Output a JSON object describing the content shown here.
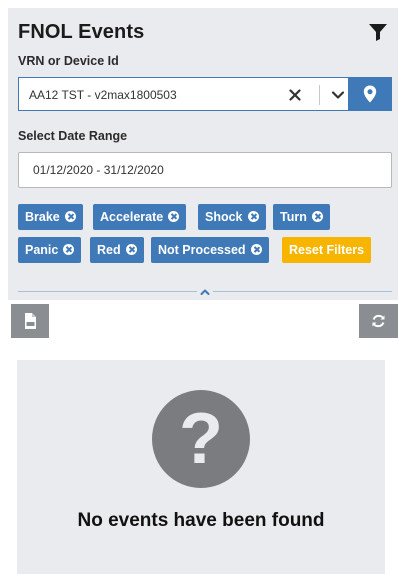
{
  "header": {
    "title": "FNOL Events"
  },
  "vrn": {
    "label": "VRN or Device Id",
    "value": "AA12 TST - v2max1800503"
  },
  "date_range": {
    "label": "Select Date Range",
    "value": "01/12/2020 - 31/12/2020"
  },
  "filters": {
    "chips": [
      {
        "label": "Brake"
      },
      {
        "label": "Accelerate"
      },
      {
        "label": "Shock"
      },
      {
        "label": "Turn"
      },
      {
        "label": "Panic"
      },
      {
        "label": "Red"
      },
      {
        "label": "Not Processed"
      }
    ],
    "reset_label": "Reset Filters"
  },
  "toolbar": {
    "csv_icon": "csv-file-icon",
    "refresh_icon": "refresh-icon"
  },
  "empty_state": {
    "icon": "question-circle-icon",
    "glyph": "?",
    "message": "No events have been found"
  },
  "colors": {
    "primary": "#3f79b8",
    "reset": "#f7b500",
    "panel_bg": "#eaebef",
    "grey_button": "#8a8d92",
    "empty_icon": "#7a7c80"
  }
}
